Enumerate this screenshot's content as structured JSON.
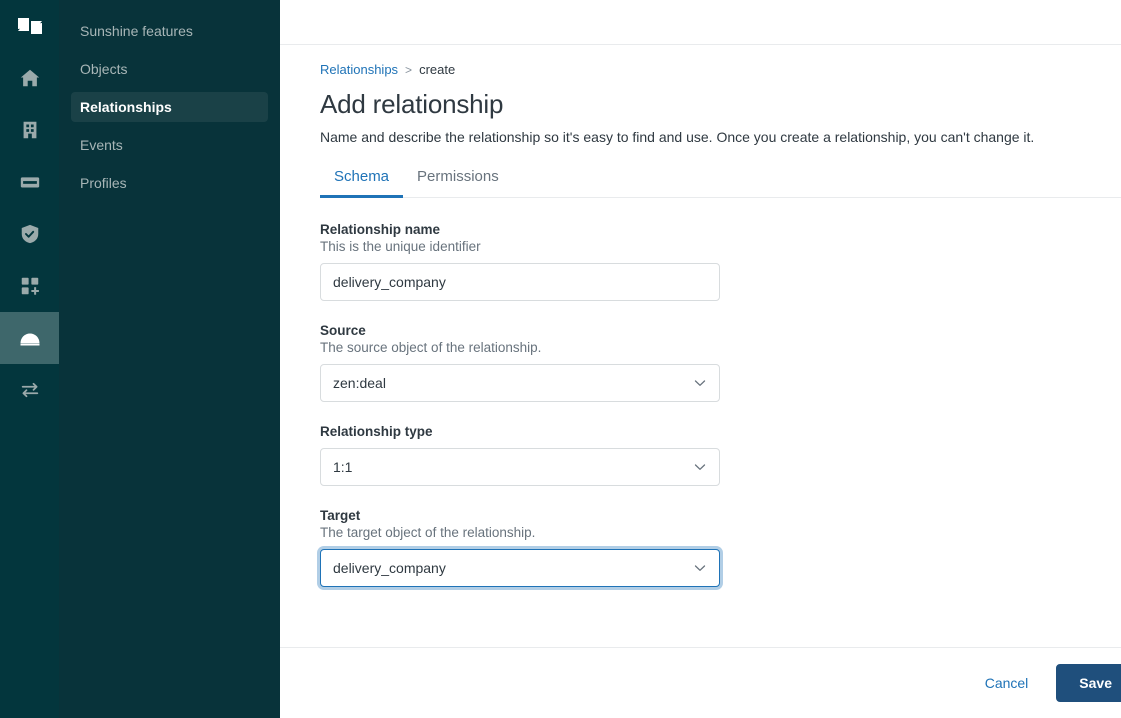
{
  "rail": {
    "logo": "zendesk-logo",
    "items": [
      {
        "icon": "home-icon",
        "active": false
      },
      {
        "icon": "building-icon",
        "active": false
      },
      {
        "icon": "ticket-icon",
        "active": false
      },
      {
        "icon": "shield-check-icon",
        "active": false
      },
      {
        "icon": "apps-add-icon",
        "active": false
      },
      {
        "icon": "sunshine-icon",
        "active": true
      },
      {
        "icon": "transfer-arrows-icon",
        "active": false
      }
    ]
  },
  "sidebar": {
    "items": [
      {
        "label": "Sunshine features",
        "active": false
      },
      {
        "label": "Objects",
        "active": false
      },
      {
        "label": "Relationships",
        "active": true
      },
      {
        "label": "Events",
        "active": false
      },
      {
        "label": "Profiles",
        "active": false
      }
    ]
  },
  "breadcrumb": {
    "parent": "Relationships",
    "separator": ">",
    "current": "create"
  },
  "header": {
    "title": "Add relationship",
    "description": "Name and describe the relationship so it's easy to find and use. Once you create a relationship, you can't change it."
  },
  "tabs": [
    {
      "label": "Schema",
      "active": true
    },
    {
      "label": "Permissions",
      "active": false
    }
  ],
  "form": {
    "name": {
      "label": "Relationship name",
      "hint": "This is the unique identifier",
      "value": "delivery_company",
      "placeholder": ""
    },
    "source": {
      "label": "Source",
      "hint": "The source object of the relationship.",
      "value": "zen:deal"
    },
    "type": {
      "label": "Relationship type",
      "hint": "",
      "value": "1:1"
    },
    "target": {
      "label": "Target",
      "hint": "The target object of the relationship.",
      "value": "delivery_company",
      "focused": true
    }
  },
  "footer": {
    "cancel_label": "Cancel",
    "save_label": "Save"
  },
  "colors": {
    "rail_bg": "#03363D",
    "subnav_bg": "#08333A",
    "nav_active_bg": "#1A4147",
    "rail_active_bg": "#3E676B",
    "link_blue": "#1f73b7",
    "save_navy": "#1f4f7c",
    "text_primary": "#2f3941",
    "text_muted": "#68737d",
    "border": "#d8dcde"
  }
}
